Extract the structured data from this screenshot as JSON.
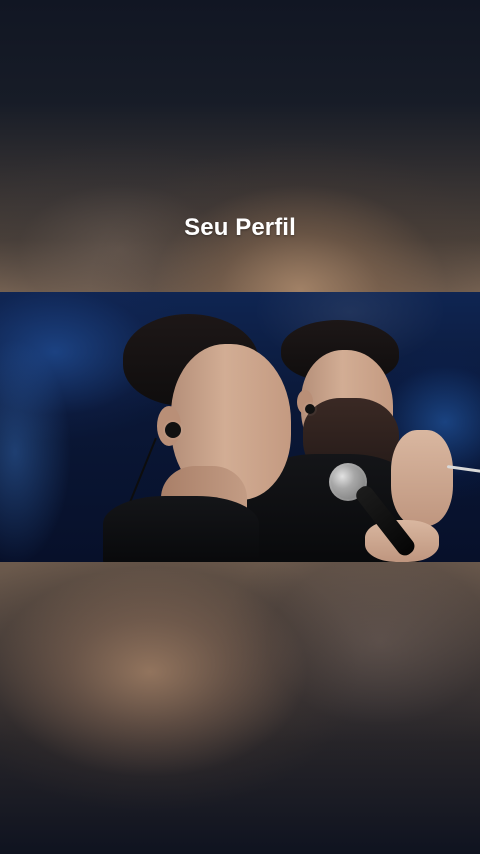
{
  "screen": {
    "title": "Seu Perfil"
  },
  "media": {
    "scene": "video-frame"
  },
  "colors": {
    "text": "#ffffff",
    "stage_blue": "#0f2552",
    "blur_warm": "#8b6c54",
    "background_dark": "#0f131c"
  }
}
